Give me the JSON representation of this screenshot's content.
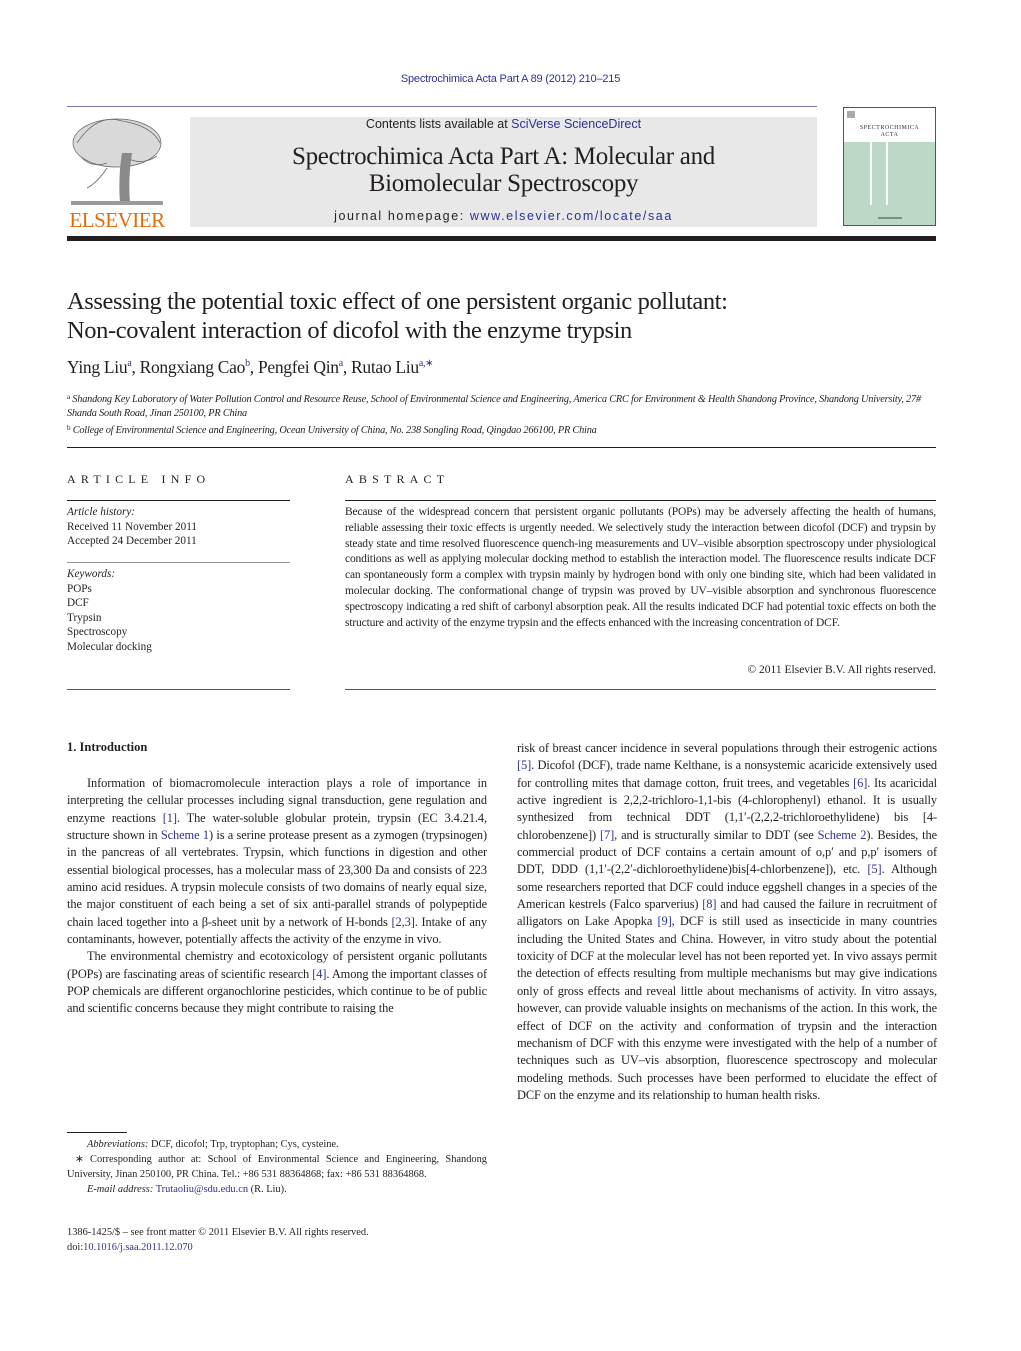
{
  "header": {
    "citation": "Spectrochimica Acta Part A 89 (2012) 210–215",
    "contents_prefix": "Contents lists available at ",
    "contents_link": "SciVerse ScienceDirect",
    "journal_title_line1": "Spectrochimica Acta Part A: Molecular and",
    "journal_title_line2": "Biomolecular Spectroscopy",
    "homepage_prefix": "journal homepage: ",
    "homepage_link": "www.elsevier.com/locate/saa",
    "publisher_logo_text": "ELSEVIER",
    "cover_title_line1": "SPECTROCHIMICA",
    "cover_title_line2": "ACTA"
  },
  "article": {
    "title_line1": "Assessing the potential toxic effect of one persistent organic pollutant:",
    "title_line2": "Non-covalent interaction of dicofol with the enzyme trypsin",
    "authors": [
      {
        "name": "Ying Liu",
        "sup": "a"
      },
      {
        "name": "Rongxiang Cao",
        "sup": "b"
      },
      {
        "name": "Pengfei Qin",
        "sup": "a"
      },
      {
        "name": "Rutao Liu",
        "sup": "a,∗"
      }
    ],
    "affiliations": [
      {
        "mark": "a",
        "text": "Shandong Key Laboratory of Water Pollution Control and Resource Reuse, School of Environmental Science and Engineering, America CRC for Environment & Health Shandong Province, Shandong University, 27# Shanda South Road, Jinan 250100, PR China"
      },
      {
        "mark": "b",
        "text": "College of Environmental Science and Engineering, Ocean University of China, No. 238 Songling Road, Qingdao 266100, PR China"
      }
    ]
  },
  "article_info": {
    "heading": "ARTICLE INFO",
    "history_label": "Article history:",
    "received": "Received 11 November 2011",
    "accepted": "Accepted 24 December 2011",
    "keywords_label": "Keywords:",
    "keywords": [
      "POPs",
      "DCF",
      "Trypsin",
      "Spectroscopy",
      "Molecular docking"
    ]
  },
  "abstract": {
    "heading": "ABSTRACT",
    "text": "Because of the widespread concern that persistent organic pollutants (POPs) may be adversely affecting the health of humans, reliable assessing their toxic effects is urgently needed. We selectively study the interaction between dicofol (DCF) and trypsin by steady state and time resolved fluorescence quench-ing measurements and UV–visible absorption spectroscopy under physiological conditions as well as applying molecular docking method to establish the interaction model. The fluorescence results indicate DCF can spontaneously form a complex with trypsin mainly by hydrogen bond with only one binding site, which had been validated in molecular docking. The conformational change of trypsin was proved by UV–visible absorption and synchronous fluorescence spectroscopy indicating a red shift of carbonyl absorption peak. All the results indicated DCF had potential toxic effects on both the structure and activity of the enzyme trypsin and the effects enhanced with the increasing concentration of DCF.",
    "copyright": "© 2011 Elsevier B.V. All rights reserved."
  },
  "introduction": {
    "heading": "1.  Introduction",
    "p1": {
      "a": "Information of biomacromolecule interaction plays a role of importance in interpreting the cellular processes including signal transduction, gene regulation and enzyme reactions ",
      "ref1": "[1]",
      "b": ". The water-soluble globular protein, trypsin (EC 3.4.21.4, structure shown in ",
      "ref2": "Scheme 1",
      "c": ") is a serine protease present as a zymogen (trypsinogen) in the pancreas of all vertebrates. Trypsin, which functions in digestion and other essential biological processes, has a molecular mass of 23,300 Da and consists of 223 amino acid residues. A trypsin molecule consists of two domains of nearly equal size, the major constituent of each being a set of six anti-parallel strands of polypeptide chain laced together into a β-sheet unit by a network of H-bonds ",
      "ref3": "[2,3]",
      "d": ". Intake of any contaminants, however, potentially affects the activity of the enzyme in vivo."
    },
    "p2": {
      "a": "The environmental chemistry and ecotoxicology of persistent organic pollutants (POPs) are fascinating areas of scientific research ",
      "ref1": "[4]",
      "b": ". Among the important classes of POP chemicals are different organochlorine pesticides, which continue to be of public and scientific concerns because they might contribute to raising the risk of breast cancer incidence in several populations through their estrogenic actions ",
      "ref2": "[5]",
      "c": ". Dicofol (DCF), trade name Kelthane, is a nonsystemic acaricide extensively used for controlling mites that damage cotton, fruit trees, and vegetables ",
      "ref3": "[6]",
      "d": ". Its acaricidal active ingredient is 2,2,2-trichloro-1,1-bis (4-chlorophenyl) ethanol. It is usually synthesized from technical DDT (1,1′-(2,2,2-trichloroethylidene) bis [4-chlorobenzene]) ",
      "ref4": "[7]",
      "e": ", and is structurally similar to DDT (see ",
      "ref5": "Scheme 2",
      "f": "). Besides, the commercial product of DCF contains a certain amount of o,p′ and p,p′ isomers of DDT, DDD (1,1′-(2,2′-dichloroethylidene)bis[4-chlorbenzene]), etc. ",
      "ref6": "[5]",
      "g": ". Although some researchers reported that DCF could induce eggshell changes in a species of the American kestrels (Falco sparverius) ",
      "ref7": "[8]",
      "h": " and had caused the failure in recruitment of alligators on Lake Apopka ",
      "ref8": "[9]",
      "i": ", DCF is still used as insecticide in many countries including the United States and China. However, in vitro study about the potential toxicity of DCF at the molecular level has not been reported yet. In vivo assays permit the detection of effects resulting from multiple mechanisms but may give indications only of gross effects and reveal little about mechanisms of activity. In vitro assays, however, can provide valuable insights on mechanisms of the action. In this work, the effect of DCF on the activity and conformation of trypsin and the interaction mechanism of DCF with this enzyme were investigated with the help of a number of techniques such as UV–vis absorption, fluorescence spectroscopy and molecular modeling methods. Such processes have been performed to elucidate the effect of DCF on the enzyme and its relationship to human health risks."
    }
  },
  "footnotes": {
    "abbrev_label": "Abbreviations:",
    "abbrev_text": " DCF, dicofol; Trp, tryptophan; Cys, cysteine.",
    "corresponding": "∗ Corresponding author at: School of Environmental Science and Engineering, Shandong University, Jinan 250100, PR China. Tel.: +86 531 88364868; fax: +86 531 88364868.",
    "email_label": "E-mail address:",
    "email": "Trutaoliu@sdu.edu.cn",
    "email_suffix": " (R. Liu).",
    "issn": "1386-1425/$ – see front matter © 2011 Elsevier B.V. All rights reserved.",
    "doi_prefix": "doi:",
    "doi": "10.1016/j.saa.2011.12.070"
  }
}
